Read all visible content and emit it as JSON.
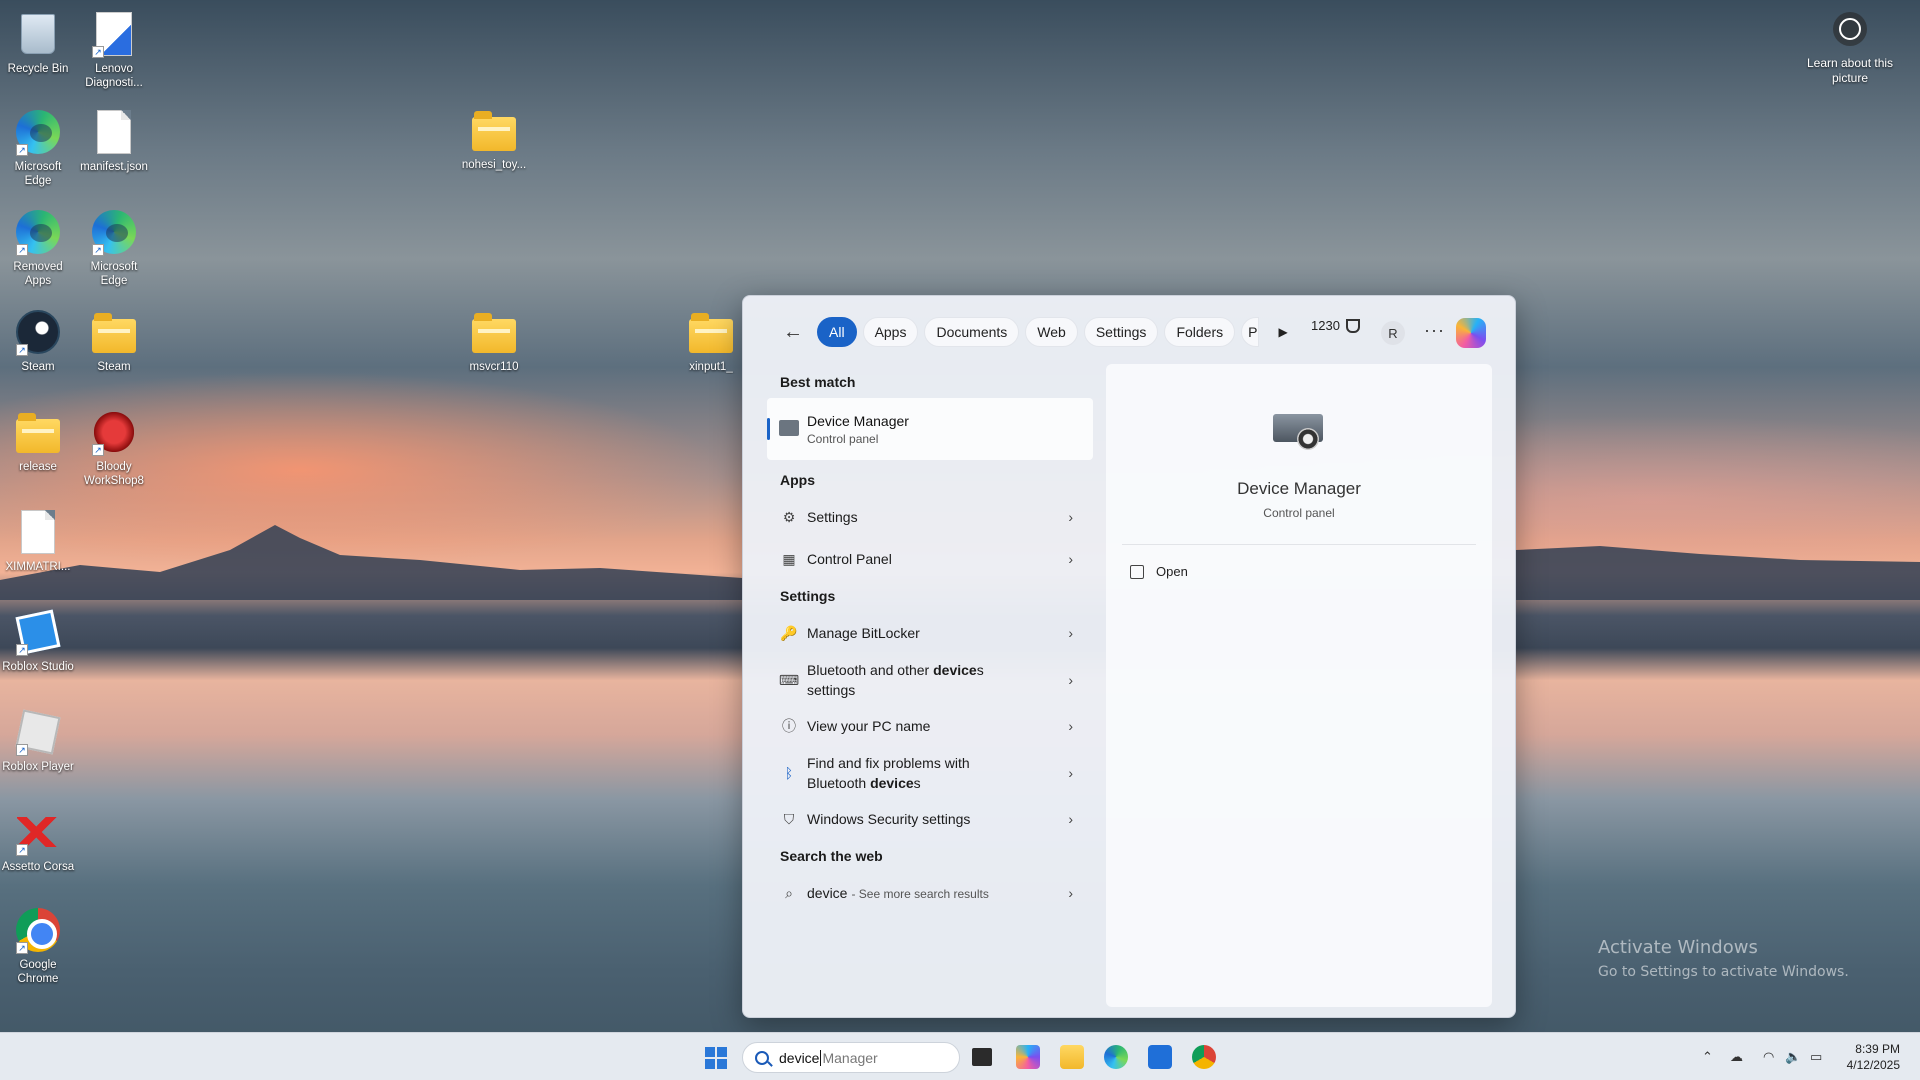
{
  "desktop": {
    "icons": [
      {
        "label": "Recycle Bin",
        "icon": "recycle-bin-icon"
      },
      {
        "label": "Lenovo Diagnosti...",
        "icon": "lenovo-diagnostics-icon"
      },
      {
        "label": "Microsoft Edge",
        "icon": "edge-icon"
      },
      {
        "label": "manifest.json",
        "icon": "file-icon"
      },
      {
        "label": "nohesi_toy...",
        "icon": "folder-icon"
      },
      {
        "label": "Removed Apps",
        "icon": "edge-icon"
      },
      {
        "label": "Microsoft Edge",
        "icon": "edge-icon"
      },
      {
        "label": "Steam",
        "icon": "steam-icon"
      },
      {
        "label": "Steam",
        "icon": "folder-icon"
      },
      {
        "label": "msvcr110",
        "icon": "folder-icon"
      },
      {
        "label": "xinput1_",
        "icon": "folder-icon"
      },
      {
        "label": "release",
        "icon": "folder-icon"
      },
      {
        "label": "Bloody WorkShop8",
        "icon": "bloody-icon"
      },
      {
        "label": "XIMMATRI...",
        "icon": "file-icon"
      },
      {
        "label": "Roblox Studio",
        "icon": "roblox-studio-icon"
      },
      {
        "label": "Roblox Player",
        "icon": "roblox-player-icon"
      },
      {
        "label": "Assetto Corsa",
        "icon": "assetto-corsa-icon"
      },
      {
        "label": "Google Chrome",
        "icon": "chrome-icon"
      }
    ],
    "learn_about": "Learn about this picture",
    "activate_title": "Activate Windows",
    "activate_sub": "Go to Settings to activate Windows."
  },
  "search_panel": {
    "filters": [
      "All",
      "Apps",
      "Documents",
      "Web",
      "Settings",
      "Folders",
      "P"
    ],
    "active_filter": "All",
    "points": "1230",
    "avatar_initial": "R",
    "best_match_title": "Best match",
    "best_match": {
      "name": "Device Manager",
      "type": "Control panel"
    },
    "apps_title": "Apps",
    "apps": [
      {
        "label": "Settings",
        "icon": "settings-gear-icon"
      },
      {
        "label": "Control Panel",
        "icon": "control-panel-icon"
      }
    ],
    "settings_title": "Settings",
    "settings": [
      {
        "pre": "Manage BitLocker",
        "bold": "",
        "post": "",
        "icon": "bitlocker-icon"
      },
      {
        "pre": "Bluetooth and other ",
        "bold": "device",
        "post": "s settings",
        "icon": "keyboard-device-icon"
      },
      {
        "pre": "View your PC name",
        "bold": "",
        "post": "",
        "icon": "info-icon"
      },
      {
        "pre": "Find and fix problems with Bluetooth ",
        "bold": "device",
        "post": "s",
        "icon": "bluetooth-icon"
      },
      {
        "pre": "Windows Security settings",
        "bold": "",
        "post": "",
        "icon": "shield-icon"
      }
    ],
    "web_title": "Search the web",
    "web": {
      "query": "device",
      "sub": "- See more search results"
    },
    "preview": {
      "name": "Device Manager",
      "type": "Control panel",
      "open": "Open"
    }
  },
  "taskbar": {
    "search_typed": "device",
    "search_ghost": "Manager",
    "time": "8:39 PM",
    "date": "4/12/2025"
  }
}
